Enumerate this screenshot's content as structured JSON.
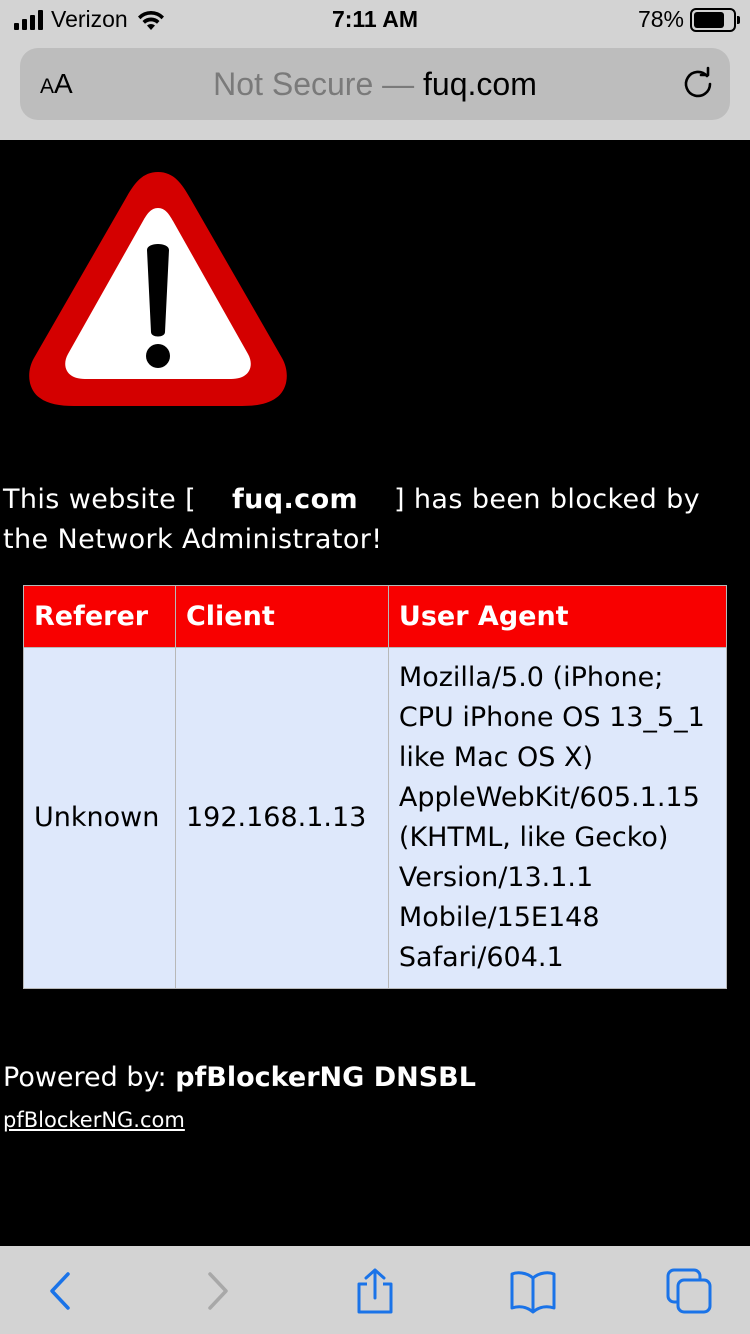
{
  "status_bar": {
    "carrier": "Verizon",
    "time": "7:11 AM",
    "battery": "78%",
    "battery_level": 0.78
  },
  "url_bar": {
    "text_size_label": "AA",
    "security_label": "Not Secure —",
    "host": "fuq.com"
  },
  "page": {
    "message_prefix": "This website [",
    "blocked_domain": "fuq.com",
    "message_suffix": "] has been blocked by the Network Administrator!",
    "table": {
      "headers": [
        "Referer",
        "Client",
        "User Agent"
      ],
      "row": {
        "referer": "Unknown",
        "client": "192.168.1.13",
        "user_agent": "Mozilla/5.0 (iPhone; CPU iPhone OS 13_5_1 like Mac OS X) AppleWebKit/605.1.15 (KHTML, like Gecko) Version/13.1.1 Mobile/15E148 Safari/604.1"
      }
    },
    "powered_label": "Powered by:",
    "powered_name": "pfBlockerNG DNSBL",
    "site_link": "pfBlockerNG.com"
  },
  "toolbar": {
    "icons": [
      "back-icon",
      "forward-icon",
      "share-icon",
      "bookmarks-icon",
      "tabs-icon"
    ]
  },
  "colors": {
    "accent_blue": "#1a73e8",
    "header_red": "#f80000",
    "cell_blue": "#dee8fb"
  }
}
